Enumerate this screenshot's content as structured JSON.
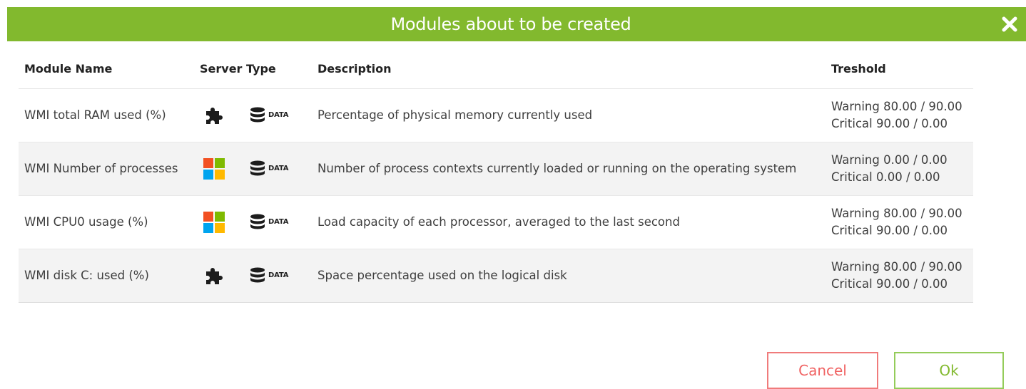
{
  "dialog": {
    "title": "Modules about to be created"
  },
  "table": {
    "headers": {
      "name": "Module Name",
      "server_type": "Server Type",
      "description": "Description",
      "threshold": "Treshold"
    },
    "rows": [
      {
        "name": "WMI total RAM used (%)",
        "type_icon": "plugin-puzzle-icon",
        "data_label": "DATA",
        "description": "Percentage of physical memory currently used",
        "warning": "Warning 80.00 / 90.00",
        "critical": "Critical 90.00 / 0.00"
      },
      {
        "name": "WMI Number of processes",
        "type_icon": "windows-logo-icon",
        "data_label": "DATA",
        "description": "Number of process contexts currently loaded or running on the operating system",
        "warning": "Warning 0.00 / 0.00",
        "critical": "Critical 0.00 / 0.00"
      },
      {
        "name": "WMI CPU0 usage (%)",
        "type_icon": "windows-logo-icon",
        "data_label": "DATA",
        "description": "Load capacity of each processor, averaged to the last second",
        "warning": "Warning 80.00 / 90.00",
        "critical": "Critical 90.00 / 0.00"
      },
      {
        "name": "WMI disk C: used (%)",
        "type_icon": "plugin-puzzle-icon",
        "data_label": "DATA",
        "description": "Space percentage used on the logical disk",
        "warning": "Warning 80.00 / 90.00",
        "critical": "Critical 90.00 / 0.00"
      }
    ]
  },
  "buttons": {
    "cancel": "Cancel",
    "ok": "Ok"
  },
  "colors": {
    "header_green": "#82b92e",
    "cancel_red": "#f06262",
    "ok_green": "#82b92e"
  }
}
